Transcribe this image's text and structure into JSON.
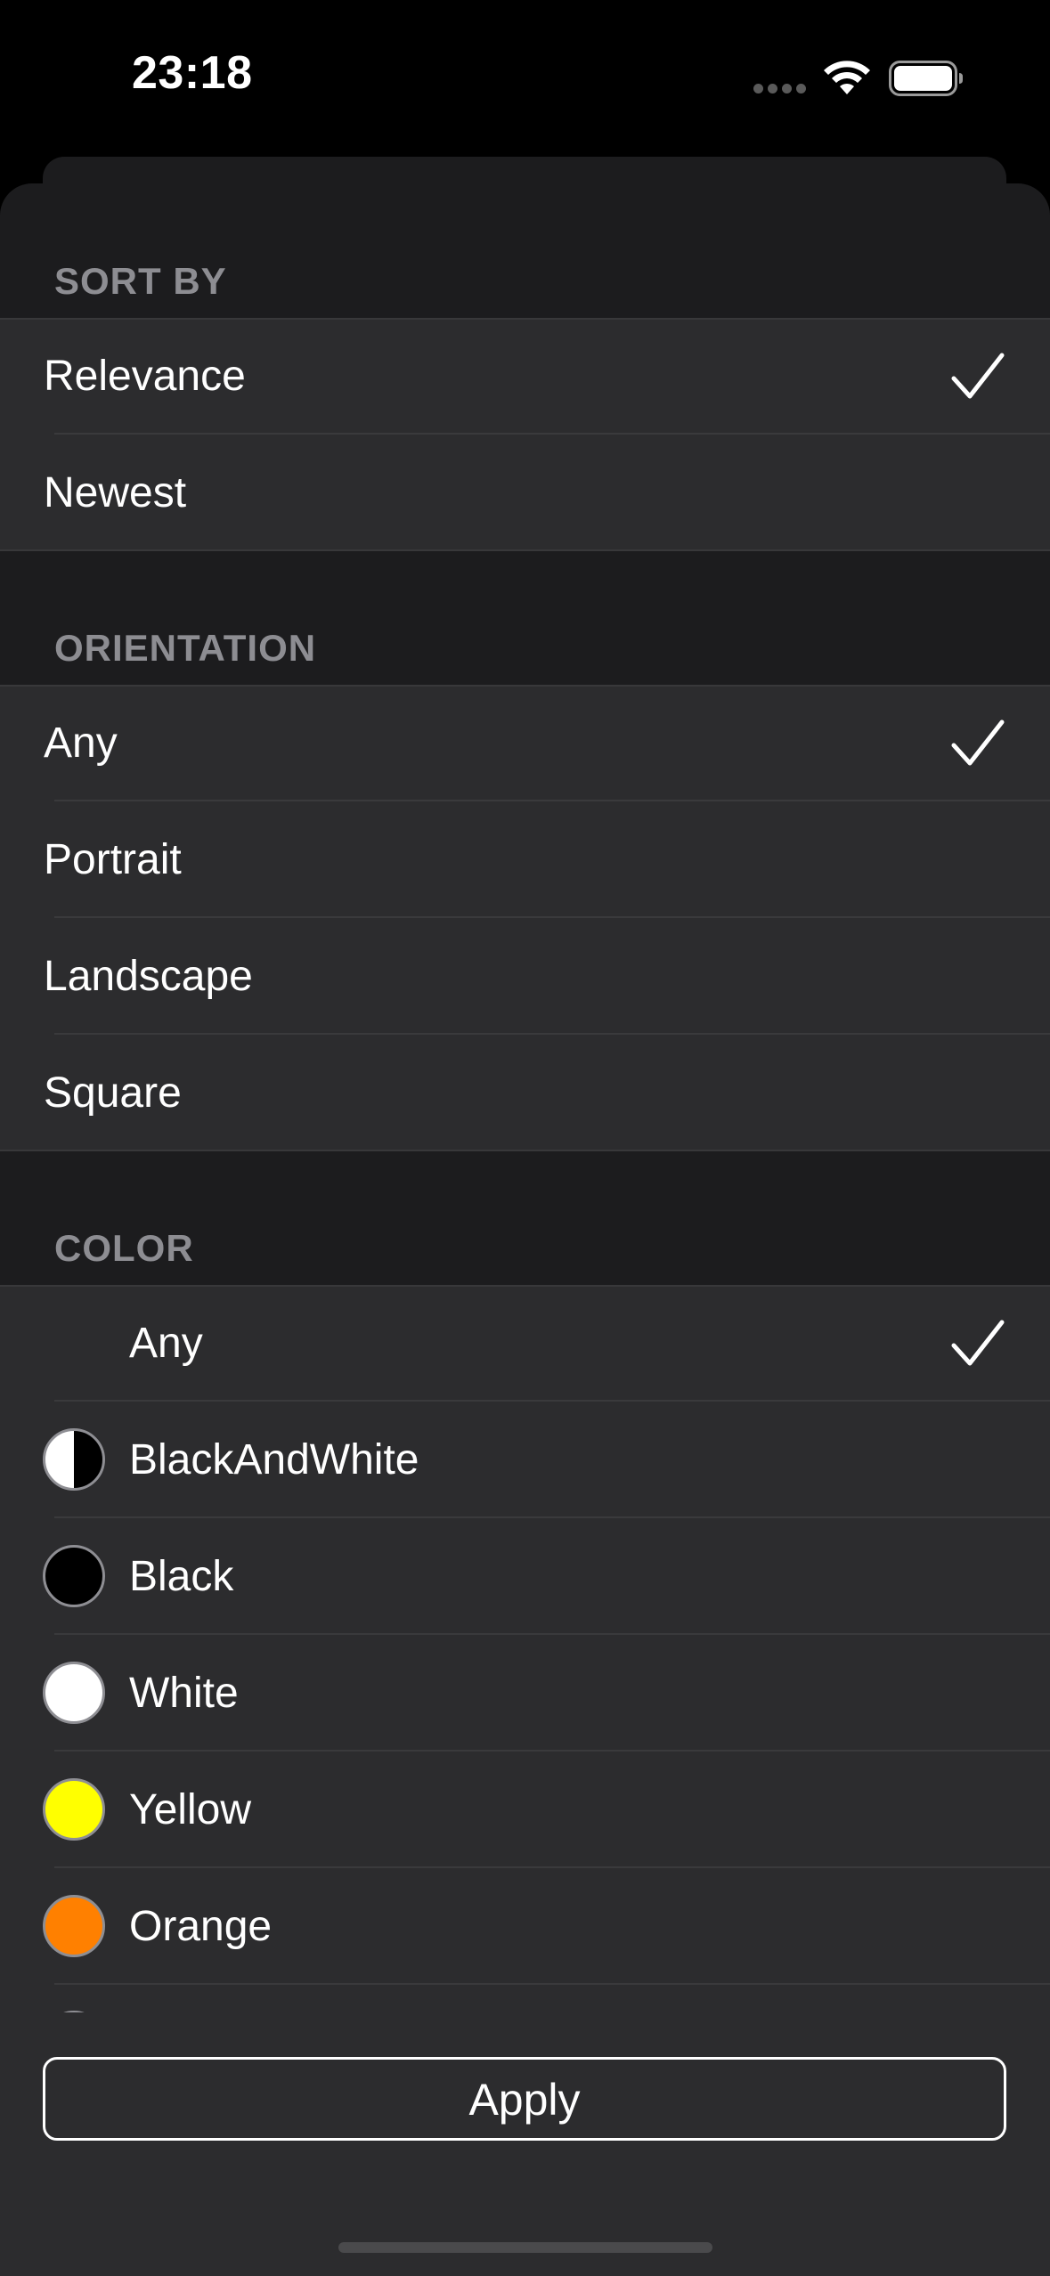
{
  "status_bar": {
    "time": "23:18",
    "wifi_icon": "wifi-icon",
    "battery_icon": "battery-icon",
    "signal_icon": "signal-dots-icon"
  },
  "sections": {
    "sort_by": {
      "header": "SORT BY",
      "items": [
        {
          "label": "Relevance",
          "selected": true
        },
        {
          "label": "Newest",
          "selected": false
        }
      ]
    },
    "orientation": {
      "header": "ORIENTATION",
      "items": [
        {
          "label": "Any",
          "selected": true
        },
        {
          "label": "Portrait",
          "selected": false
        },
        {
          "label": "Landscape",
          "selected": false
        },
        {
          "label": "Square",
          "selected": false
        }
      ]
    },
    "color": {
      "header": "COLOR",
      "items": [
        {
          "label": "Any",
          "selected": true,
          "swatch": null
        },
        {
          "label": "BlackAndWhite",
          "selected": false,
          "swatch": "half-black-white"
        },
        {
          "label": "Black",
          "selected": false,
          "swatch": "#000000"
        },
        {
          "label": "White",
          "selected": false,
          "swatch": "#ffffff"
        },
        {
          "label": "Yellow",
          "selected": false,
          "swatch": "#ffff00"
        },
        {
          "label": "Orange",
          "selected": false,
          "swatch": "#ff8000"
        }
      ]
    }
  },
  "apply_button": {
    "label": "Apply"
  },
  "colors": {
    "sheet_background": "#1c1c1e",
    "row_background": "#2c2c2e",
    "header_text": "#8d8d92",
    "checkmark": "#ffffff"
  }
}
